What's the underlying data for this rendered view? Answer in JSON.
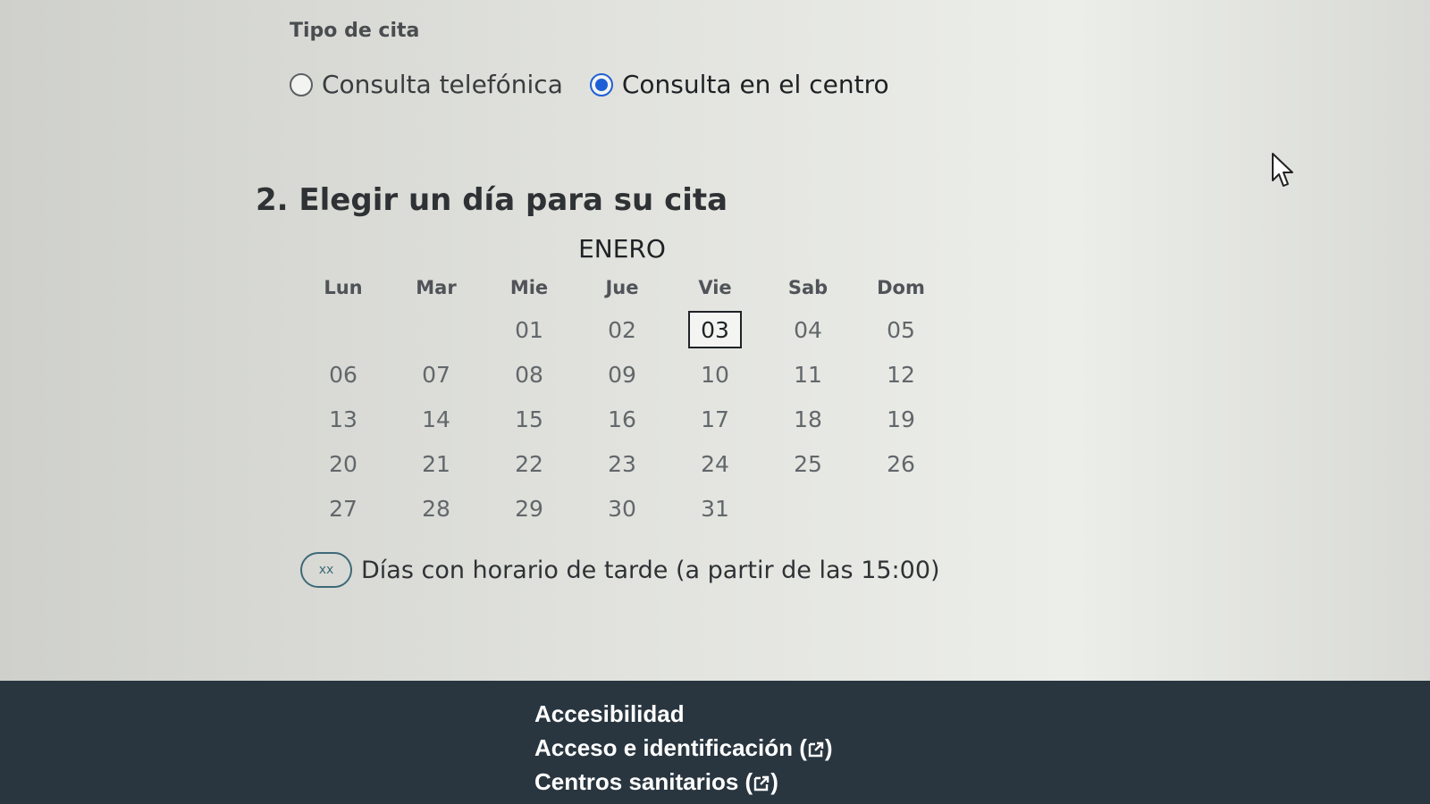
{
  "appointment_type": {
    "label": "Tipo de cita",
    "options": [
      {
        "label": "Consulta telefónica",
        "checked": false
      },
      {
        "label": "Consulta en el centro",
        "checked": true
      }
    ]
  },
  "step": {
    "number": "2.",
    "title": "Elegir un día para su cita"
  },
  "calendar": {
    "month": "ENERO",
    "weekdays": [
      "Lun",
      "Mar",
      "Mie",
      "Jue",
      "Vie",
      "Sab",
      "Dom"
    ],
    "weeks": [
      [
        "",
        "",
        "01",
        "02",
        "03",
        "04",
        "05"
      ],
      [
        "06",
        "07",
        "08",
        "09",
        "10",
        "11",
        "12"
      ],
      [
        "13",
        "14",
        "15",
        "16",
        "17",
        "18",
        "19"
      ],
      [
        "20",
        "21",
        "22",
        "23",
        "24",
        "25",
        "26"
      ],
      [
        "27",
        "28",
        "29",
        "30",
        "31",
        "",
        ""
      ]
    ],
    "selected_day": "03"
  },
  "legend": {
    "marker": "xx",
    "text": "Días con horario de tarde (a partir de las 15:00)"
  },
  "footer": {
    "links": [
      {
        "text": "Accesibilidad",
        "external": false
      },
      {
        "text": "Acceso e identificación",
        "external": true
      },
      {
        "text": "Centros sanitarios",
        "external": true
      }
    ]
  },
  "colors": {
    "accent": "#1f5fd6",
    "footer_bg": "#293640",
    "legend_border": "#3d6a78"
  }
}
